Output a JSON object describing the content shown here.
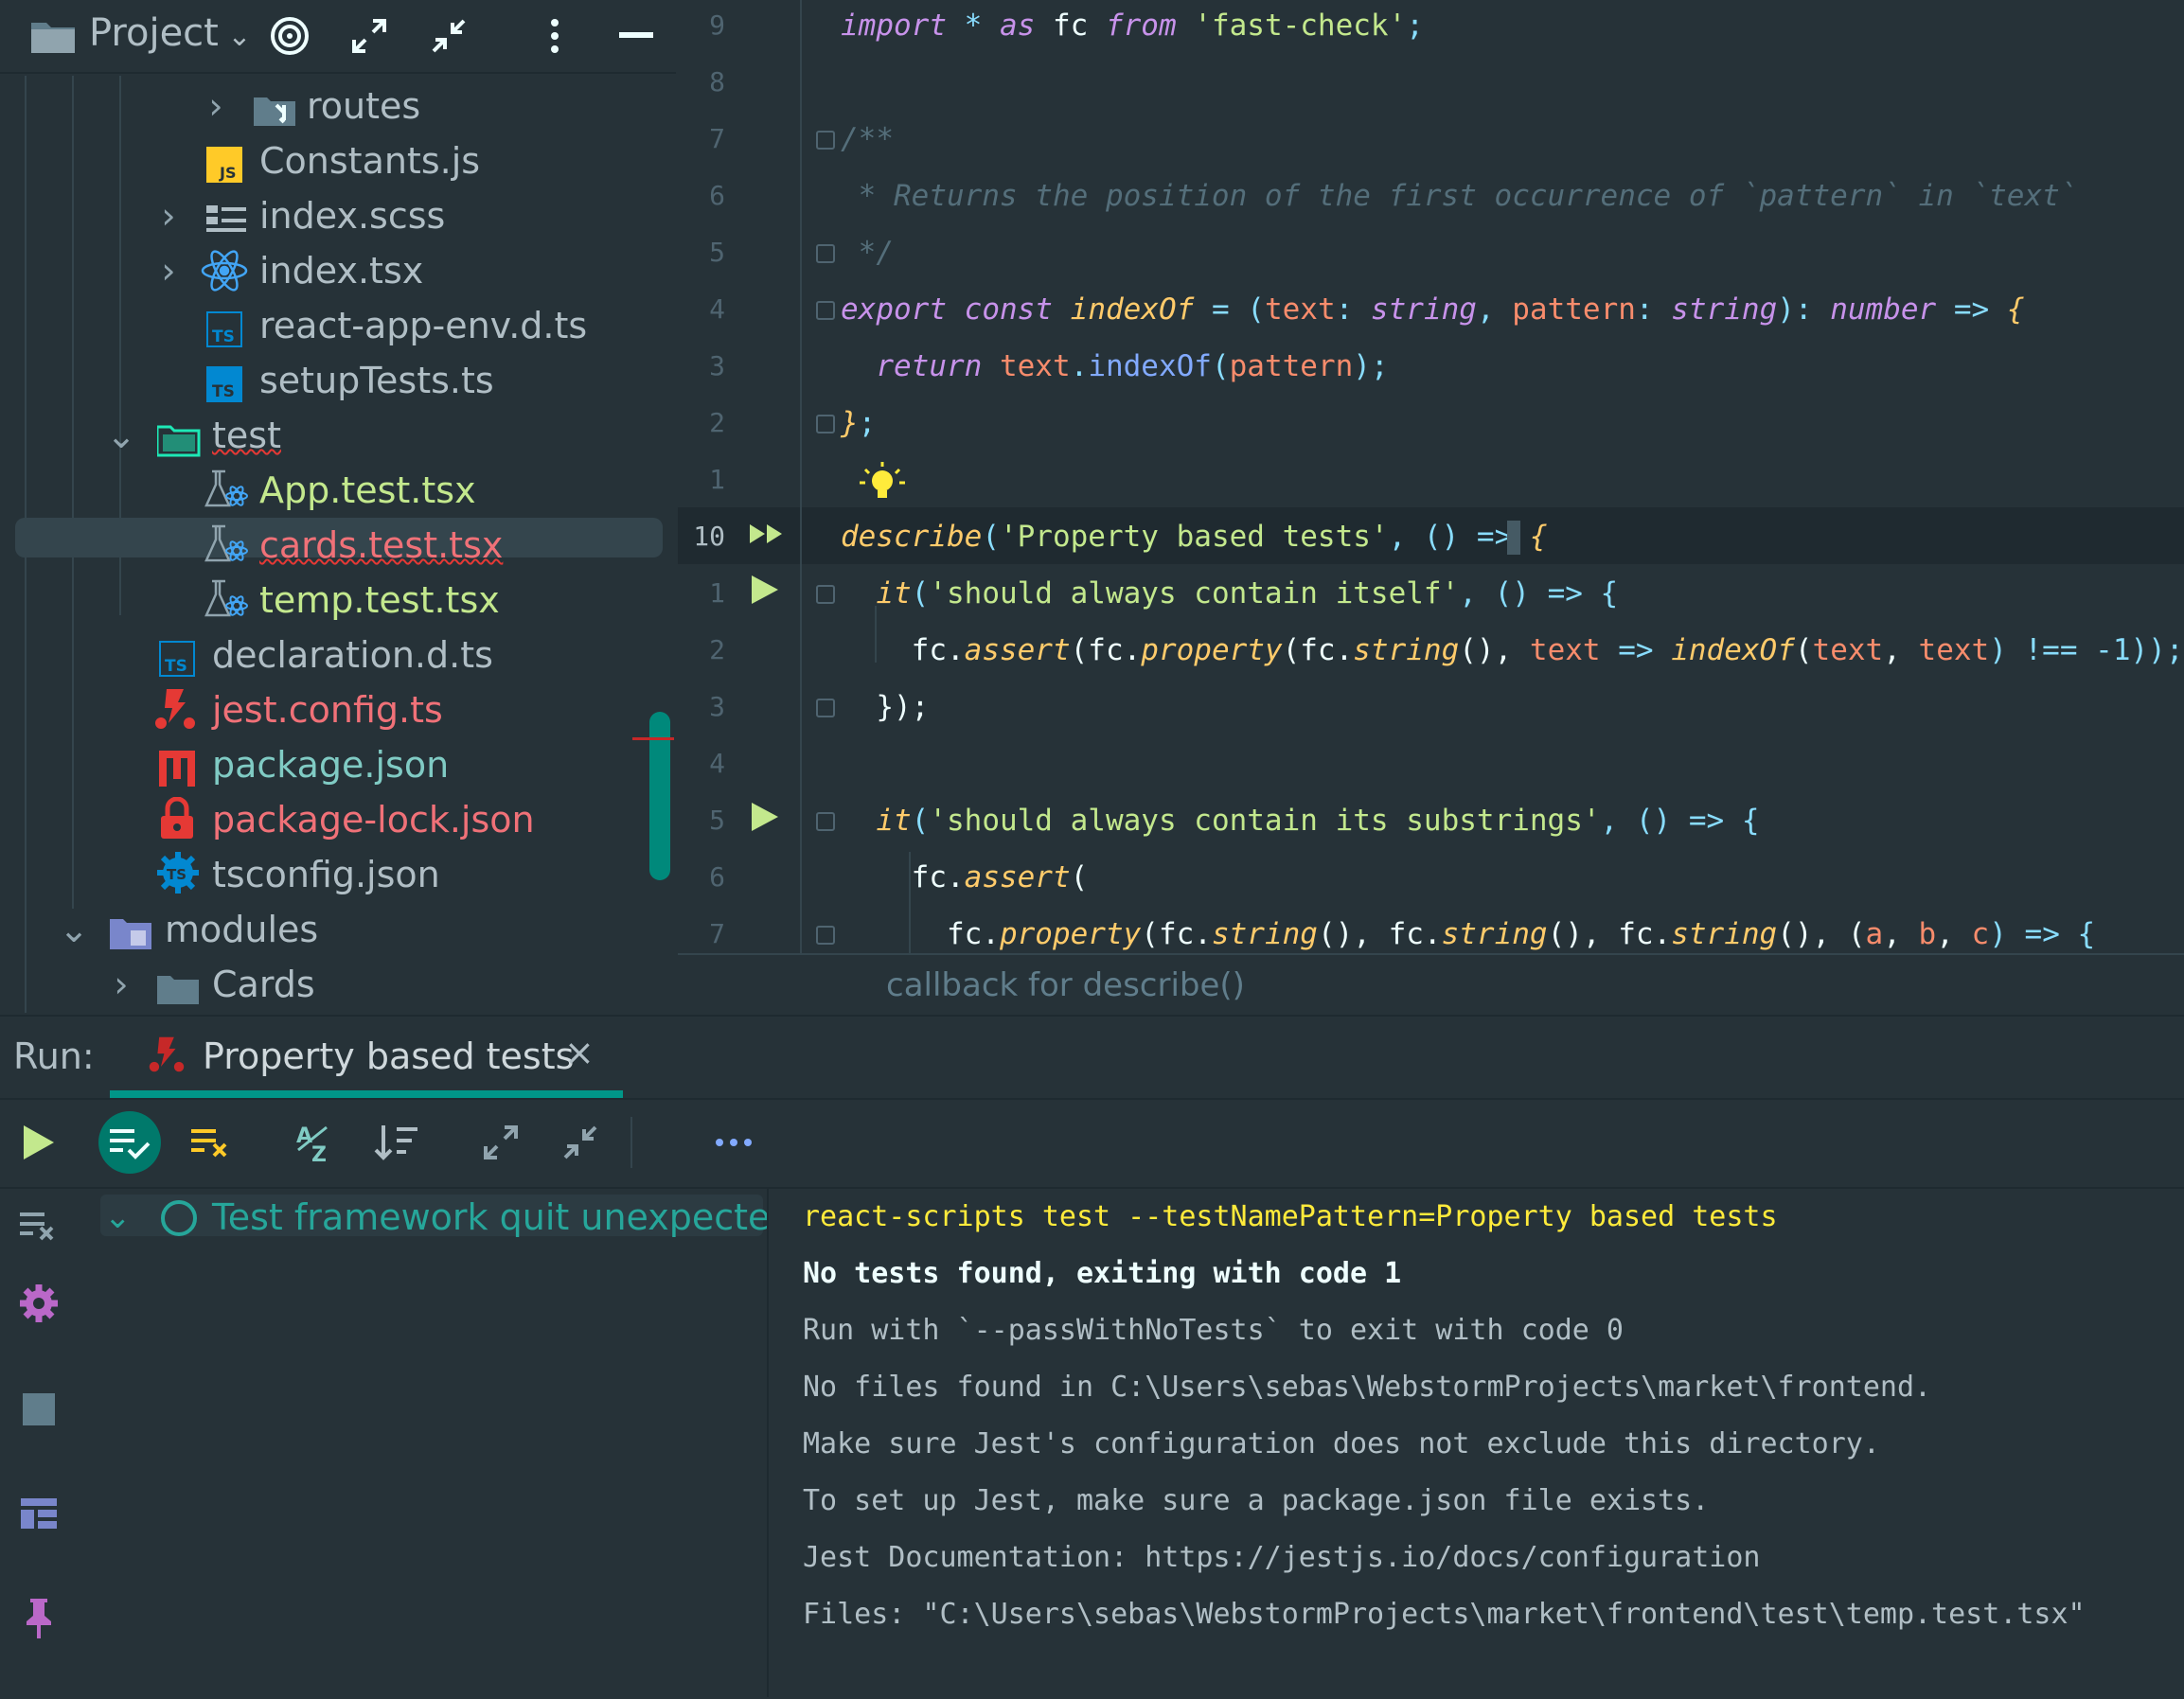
{
  "project": {
    "title": "Project",
    "tree": [
      {
        "label": "routes",
        "icon": "folder-routes-icon",
        "color": "#b0bec5"
      },
      {
        "label": "Constants.js",
        "icon": "javascript-file-icon",
        "color": "#b0bec5"
      },
      {
        "label": "index.scss",
        "icon": "scss-file-icon",
        "color": "#b0bec5"
      },
      {
        "label": "index.tsx",
        "icon": "react-file-icon",
        "color": "#b0bec5"
      },
      {
        "label": "react-app-env.d.ts",
        "icon": "typescript-file-icon",
        "color": "#b0bec5"
      },
      {
        "label": "setupTests.ts",
        "icon": "typescript-file-icon",
        "color": "#b0bec5"
      },
      {
        "label": "test",
        "icon": "test-folder-icon",
        "color": "#b0bec5"
      },
      {
        "label": "App.test.tsx",
        "icon": "react-test-file-icon",
        "color": "#c3e88d"
      },
      {
        "label": "cards.test.tsx",
        "icon": "react-test-file-icon",
        "color": "#f07178"
      },
      {
        "label": "temp.test.tsx",
        "icon": "react-test-file-icon",
        "color": "#c3e88d"
      },
      {
        "label": "declaration.d.ts",
        "icon": "typescript-file-icon",
        "color": "#b0bec5"
      },
      {
        "label": "jest.config.ts",
        "icon": "jest-file-icon",
        "color": "#f07178"
      },
      {
        "label": "package.json",
        "icon": "npm-file-icon",
        "color": "#80cbc4"
      },
      {
        "label": "package-lock.json",
        "icon": "lock-file-icon",
        "color": "#f07178"
      },
      {
        "label": "tsconfig.json",
        "icon": "tsconfig-file-icon",
        "color": "#b0bec5"
      },
      {
        "label": "modules",
        "icon": "modules-folder-icon",
        "color": "#b0bec5"
      },
      {
        "label": "Cards",
        "icon": "folder-icon",
        "color": "#b0bec5"
      }
    ]
  },
  "editor": {
    "line_numbers": [
      "9",
      "8",
      "7",
      "6",
      "5",
      "4",
      "3",
      "2",
      "1",
      "10",
      "1",
      "2",
      "3",
      "4",
      "5",
      "6",
      "7"
    ],
    "lines": [
      [
        {
          "t": "import",
          "c": "kw"
        },
        {
          "t": " * ",
          "c": "op"
        },
        {
          "t": "as",
          "c": "kw"
        },
        {
          "t": " fc ",
          "c": "plain"
        },
        {
          "t": "from",
          "c": "kw"
        },
        {
          "t": " 'fast-check'",
          "c": "str"
        },
        {
          "t": ";",
          "c": "op"
        }
      ],
      [],
      [
        {
          "t": "/**",
          "c": "cm"
        }
      ],
      [
        {
          "t": " * Returns the position of the first occurrence of `pattern` in `text`",
          "c": "cm"
        }
      ],
      [
        {
          "t": " */",
          "c": "cm"
        }
      ],
      [
        {
          "t": "export",
          "c": "kw"
        },
        {
          "t": " ",
          "c": "plain"
        },
        {
          "t": "const",
          "c": "kw"
        },
        {
          "t": " ",
          "c": "plain"
        },
        {
          "t": "indexOf",
          "c": "fn"
        },
        {
          "t": " = (",
          "c": "op"
        },
        {
          "t": "text",
          "c": "var"
        },
        {
          "t": ": ",
          "c": "op"
        },
        {
          "t": "string",
          "c": "type"
        },
        {
          "t": ", ",
          "c": "op"
        },
        {
          "t": "pattern",
          "c": "var"
        },
        {
          "t": ": ",
          "c": "op"
        },
        {
          "t": "string",
          "c": "type"
        },
        {
          "t": "): ",
          "c": "op"
        },
        {
          "t": "number",
          "c": "type"
        },
        {
          "t": " => ",
          "c": "op"
        },
        {
          "t": "{",
          "c": "fn"
        }
      ],
      [
        {
          "t": "  ",
          "c": "plain"
        },
        {
          "t": "return",
          "c": "kw"
        },
        {
          "t": " ",
          "c": "plain"
        },
        {
          "t": "text",
          "c": "var"
        },
        {
          "t": ".",
          "c": "op"
        },
        {
          "t": "indexOf",
          "c": "meth"
        },
        {
          "t": "(",
          "c": "op"
        },
        {
          "t": "pattern",
          "c": "var"
        },
        {
          "t": ");",
          "c": "op"
        }
      ],
      [
        {
          "t": "}",
          "c": "fn"
        },
        {
          "t": ";",
          "c": "op"
        }
      ],
      [],
      [
        {
          "t": "describe",
          "c": "fn"
        },
        {
          "t": "(",
          "c": "op"
        },
        {
          "t": "'Property based tests'",
          "c": "str"
        },
        {
          "t": ", () => ",
          "c": "op"
        },
        {
          "t": "{",
          "c": "fn"
        }
      ],
      [
        {
          "t": "  ",
          "c": "plain"
        },
        {
          "t": "it",
          "c": "fn"
        },
        {
          "t": "(",
          "c": "op"
        },
        {
          "t": "'should always contain itself'",
          "c": "str"
        },
        {
          "t": ", () => {",
          "c": "op"
        }
      ],
      [
        {
          "t": "    fc.",
          "c": "plain"
        },
        {
          "t": "assert",
          "c": "fn"
        },
        {
          "t": "(fc.",
          "c": "plain"
        },
        {
          "t": "property",
          "c": "fn"
        },
        {
          "t": "(fc.",
          "c": "plain"
        },
        {
          "t": "string",
          "c": "fn"
        },
        {
          "t": "(), ",
          "c": "plain"
        },
        {
          "t": "text",
          "c": "var"
        },
        {
          "t": " => ",
          "c": "op"
        },
        {
          "t": "indexOf",
          "c": "fn"
        },
        {
          "t": "(",
          "c": "plain"
        },
        {
          "t": "text",
          "c": "var"
        },
        {
          "t": ", ",
          "c": "plain"
        },
        {
          "t": "text",
          "c": "var"
        },
        {
          "t": ") !== -1));",
          "c": "op"
        }
      ],
      [
        {
          "t": "  });",
          "c": "plain"
        }
      ],
      [],
      [
        {
          "t": "  ",
          "c": "plain"
        },
        {
          "t": "it",
          "c": "fn"
        },
        {
          "t": "(",
          "c": "op"
        },
        {
          "t": "'should always contain its substrings'",
          "c": "str"
        },
        {
          "t": ", () => {",
          "c": "op"
        }
      ],
      [
        {
          "t": "    fc.",
          "c": "plain"
        },
        {
          "t": "assert",
          "c": "fn"
        },
        {
          "t": "(",
          "c": "plain"
        }
      ],
      [
        {
          "t": "      fc.",
          "c": "plain"
        },
        {
          "t": "property",
          "c": "fn"
        },
        {
          "t": "(fc.",
          "c": "plain"
        },
        {
          "t": "string",
          "c": "fn"
        },
        {
          "t": "(), fc.",
          "c": "plain"
        },
        {
          "t": "string",
          "c": "fn"
        },
        {
          "t": "(), fc.",
          "c": "plain"
        },
        {
          "t": "string",
          "c": "fn"
        },
        {
          "t": "(), (",
          "c": "plain"
        },
        {
          "t": "a",
          "c": "var"
        },
        {
          "t": ", ",
          "c": "plain"
        },
        {
          "t": "b",
          "c": "var"
        },
        {
          "t": ", ",
          "c": "plain"
        },
        {
          "t": "c",
          "c": "var"
        },
        {
          "t": ") => {",
          "c": "op"
        }
      ]
    ],
    "breadcrumb": "callback for describe()"
  },
  "run": {
    "label": "Run:",
    "tab_label": "Property based tests",
    "tab_close": "×",
    "test_status": "Test framework quit unexpectedly",
    "console": [
      {
        "text": "react-scripts test --testNamePattern=Property based tests",
        "color": "#ffeb3b",
        "bold": false
      },
      {
        "text": "No tests found, exiting with code 1",
        "color": "#eeffff",
        "bold": true
      },
      {
        "text": "Run with `--passWithNoTests` to exit with code 0",
        "color": "#b0bec5",
        "bold": false
      },
      {
        "text": "No files found in C:\\Users\\sebas\\WebstormProjects\\market\\frontend.",
        "color": "#b0bec5",
        "bold": false
      },
      {
        "text": "Make sure Jest's configuration does not exclude this directory.",
        "color": "#b0bec5",
        "bold": false
      },
      {
        "text": "To set up Jest, make sure a package.json file exists.",
        "color": "#b0bec5",
        "bold": false
      },
      {
        "text": "Jest Documentation: https://jestjs.io/docs/configuration",
        "color": "#b0bec5",
        "bold": false
      },
      {
        "text": "Files: \"C:\\Users\\sebas\\WebstormProjects\\market\\frontend\\test\\temp.test.tsx\"",
        "color": "#b0bec5",
        "bold": false
      }
    ]
  },
  "colors": {
    "background": "#263238",
    "accent": "#009688",
    "error": "#f07178",
    "success": "#c3e88d"
  }
}
